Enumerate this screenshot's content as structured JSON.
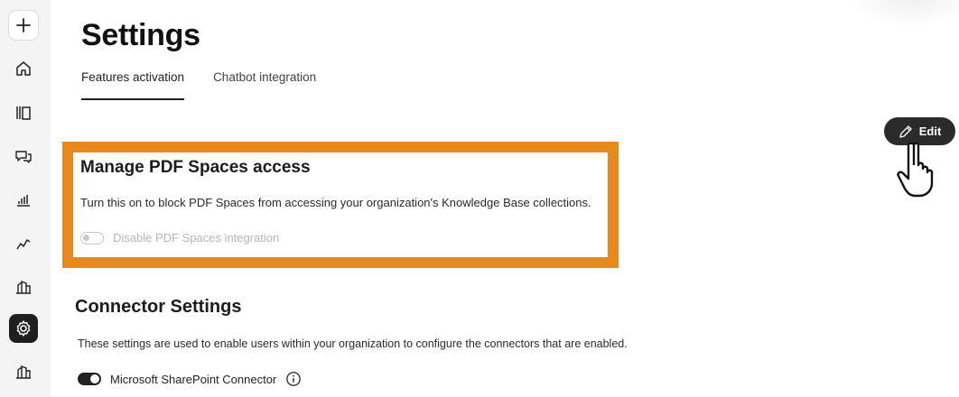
{
  "page": {
    "title": "Settings"
  },
  "tabs": [
    {
      "label": "Features activation",
      "active": true
    },
    {
      "label": "Chatbot integration",
      "active": false
    }
  ],
  "manage_pdf": {
    "title": "Manage PDF Spaces access",
    "description": "Turn this on to block PDF Spaces from accessing your organization's Knowledge Base collections.",
    "toggle_label": "Disable PDF Spaces integration",
    "toggle_on": false
  },
  "connector": {
    "title": "Connector Settings",
    "description": "These settings are used to enable users within your organization to configure the connectors that are enabled.",
    "sharepoint_label": "Microsoft SharePoint Connector",
    "sharepoint_on": true
  },
  "edit_button": {
    "label": "Edit"
  },
  "colors": {
    "highlight": "#e8891e",
    "accent": "#2b2b2b"
  },
  "sidebar": {
    "icons": [
      "plus-icon",
      "home-icon",
      "library-icon",
      "chat-icon",
      "bar-chart-icon",
      "trend-icon",
      "buildings-icon",
      "settings-icon",
      "buildings-icon"
    ],
    "active": "settings-icon"
  }
}
